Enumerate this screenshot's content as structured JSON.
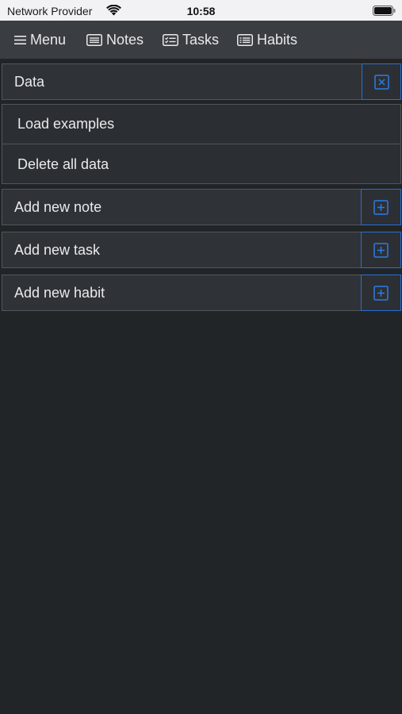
{
  "status_bar": {
    "carrier": "Network Provider",
    "time": "10:58"
  },
  "navbar": {
    "menu": "Menu",
    "notes": "Notes",
    "tasks": "Tasks",
    "habits": "Habits"
  },
  "data_section": {
    "title": "Data",
    "items": [
      "Load examples",
      "Delete all data"
    ]
  },
  "actions": {
    "add_note": "Add new note",
    "add_task": "Add new task",
    "add_habit": "Add new habit"
  },
  "colors": {
    "background": "#222528",
    "navbar": "#3a3d41",
    "row": "#2f3236",
    "accent_blue": "#2a6fd1"
  }
}
